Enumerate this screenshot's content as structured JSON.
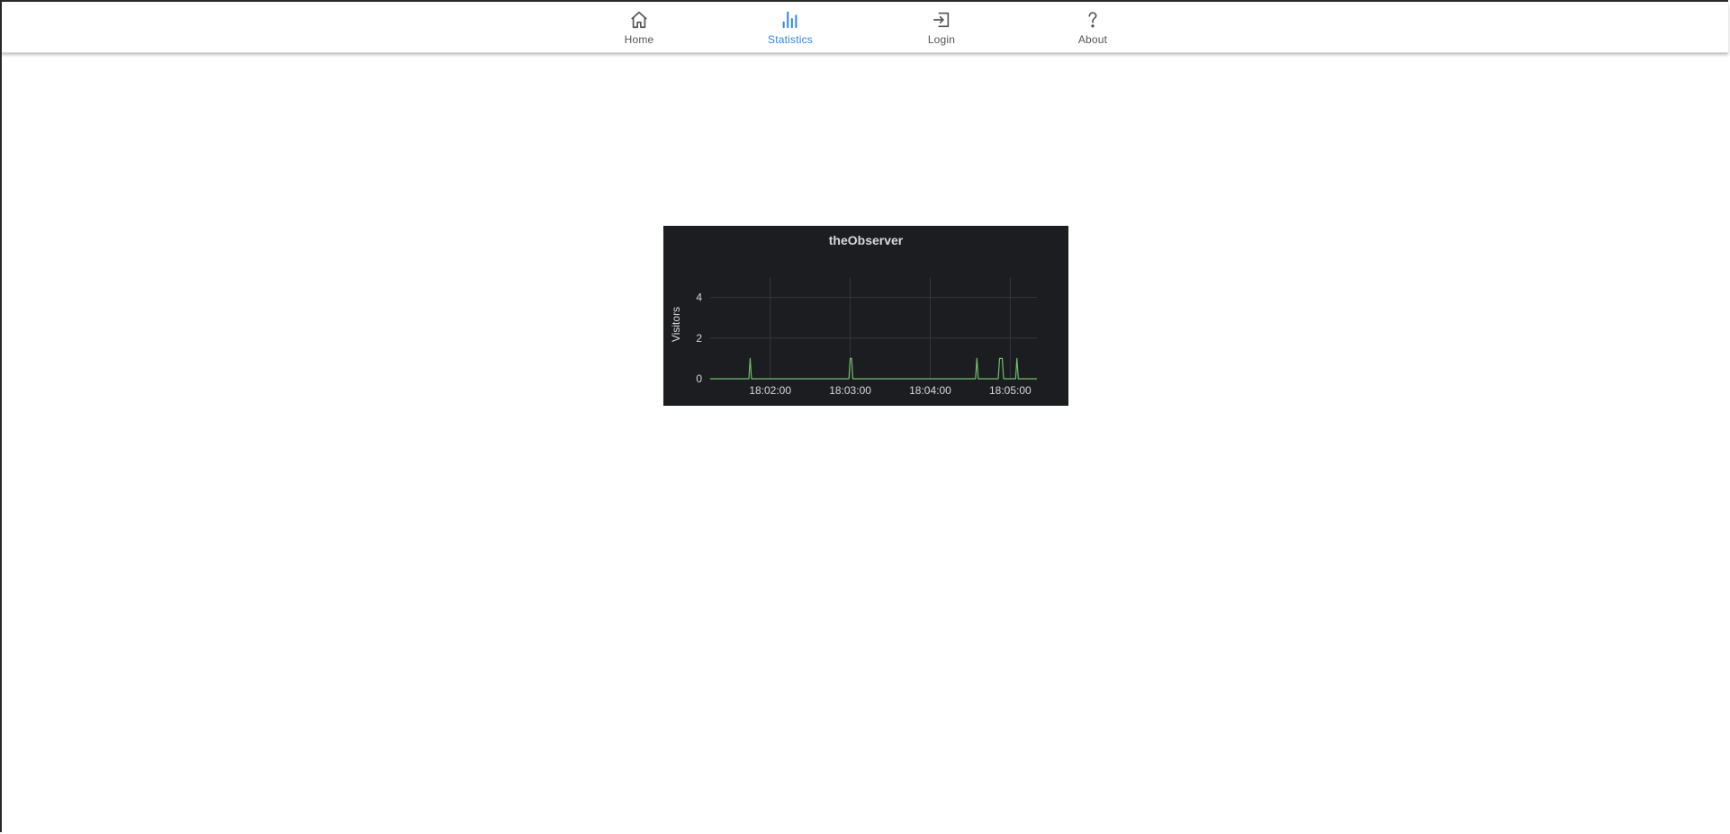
{
  "nav": {
    "items": [
      {
        "label": "Home",
        "icon": "home-icon"
      },
      {
        "label": "Statistics",
        "icon": "bar-chart-icon"
      },
      {
        "label": "Login",
        "icon": "login-icon"
      },
      {
        "label": "About",
        "icon": "question-icon"
      }
    ],
    "active": "Statistics",
    "active_color": "#2f86e8",
    "inactive_color": "#555555"
  },
  "panel": {
    "background": "#1b1d21",
    "title": "theObserver"
  },
  "chart_data": {
    "type": "line",
    "title": "theObserver",
    "xlabel": "",
    "ylabel": "Visitors",
    "series_color": "#73bf69",
    "grid": true,
    "x_ticks": [
      "18:02:00",
      "18:03:00",
      "18:04:00",
      "18:05:00"
    ],
    "y_ticks": [
      0,
      2,
      4
    ],
    "ylim": [
      0,
      5
    ],
    "xlim": [
      "18:01:15",
      "18:05:20"
    ],
    "x": [
      "18:01:15",
      "18:01:44",
      "18:01:45",
      "18:01:46",
      "18:02:59",
      "18:03:00",
      "18:03:01",
      "18:03:02",
      "18:04:34",
      "18:04:35",
      "18:04:36",
      "18:04:51",
      "18:04:52",
      "18:04:53",
      "18:04:54",
      "18:04:55",
      "18:05:04",
      "18:05:05",
      "18:05:06",
      "18:05:20"
    ],
    "values": [
      0,
      0,
      1,
      0,
      0,
      1,
      1,
      0,
      0,
      1,
      0,
      0,
      1,
      1,
      1,
      0,
      0,
      1,
      0,
      0
    ]
  }
}
